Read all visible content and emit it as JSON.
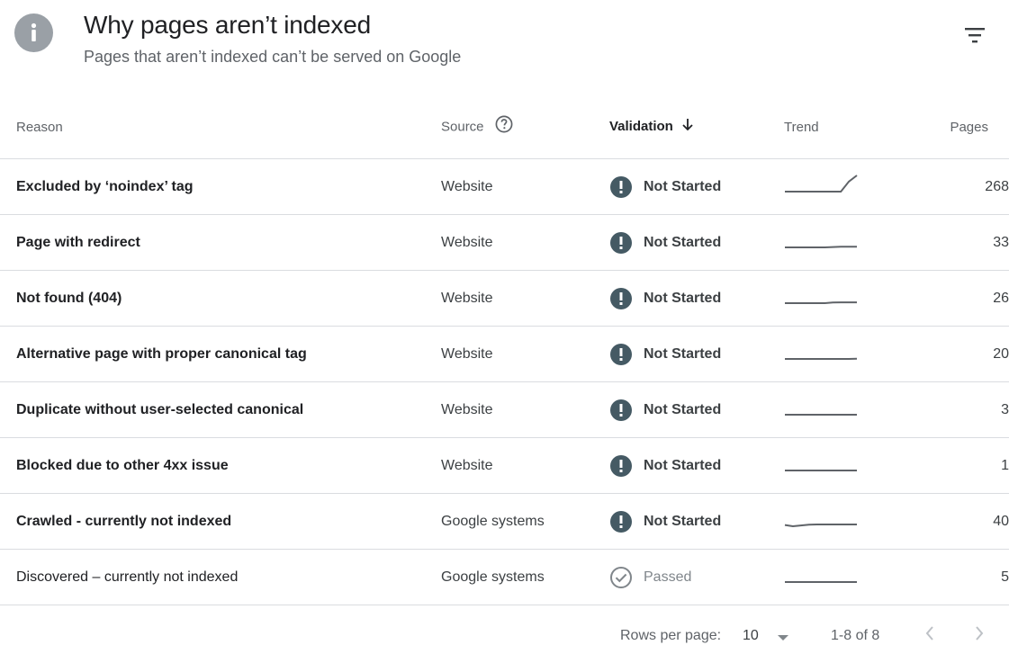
{
  "header": {
    "title": "Why pages aren’t indexed",
    "subtitle": "Pages that aren’t indexed can’t be served on Google",
    "info_icon": "info-icon",
    "filter_icon": "filter-icon"
  },
  "table": {
    "columns": {
      "reason": "Reason",
      "source": "Source",
      "validation": "Validation",
      "trend": "Trend",
      "pages": "Pages"
    },
    "sorted_by": "validation",
    "sort_direction": "descending",
    "rows": [
      {
        "reason": "Excluded by ‘noindex’ tag",
        "source": "Website",
        "validation": "Not Started",
        "status": "not-started",
        "pages": "268",
        "trend": [
          1,
          1,
          1,
          1,
          1,
          1,
          1,
          1,
          6,
          9
        ]
      },
      {
        "reason": "Page with redirect",
        "source": "Website",
        "validation": "Not Started",
        "status": "not-started",
        "pages": "33",
        "trend": [
          1,
          1,
          1,
          1,
          1,
          1,
          1.2,
          1.3,
          1.3,
          1.3
        ]
      },
      {
        "reason": "Not found (404)",
        "source": "Website",
        "validation": "Not Started",
        "status": "not-started",
        "pages": "26",
        "trend": [
          1,
          1,
          1,
          1,
          1,
          1,
          1.3,
          1.4,
          1.4,
          1.4
        ]
      },
      {
        "reason": "Alternative page with proper canonical tag",
        "source": "Website",
        "validation": "Not Started",
        "status": "not-started",
        "pages": "20",
        "trend": [
          1,
          1,
          1,
          1,
          1,
          1,
          1,
          1,
          1,
          1.1
        ]
      },
      {
        "reason": "Duplicate without user-selected canonical",
        "source": "Website",
        "validation": "Not Started",
        "status": "not-started",
        "pages": "3",
        "trend": [
          1,
          1,
          1,
          1,
          1,
          1,
          1,
          1,
          1,
          1
        ]
      },
      {
        "reason": "Blocked due to other 4xx issue",
        "source": "Website",
        "validation": "Not Started",
        "status": "not-started",
        "pages": "1",
        "trend": [
          1,
          1,
          1,
          1,
          1,
          1,
          1,
          1,
          1,
          1
        ]
      },
      {
        "reason": "Crawled - currently not indexed",
        "source": "Google systems",
        "validation": "Not Started",
        "status": "not-started",
        "pages": "40",
        "trend": [
          1.6,
          1,
          1.4,
          1.8,
          1.9,
          1.9,
          1.9,
          1.9,
          1.9,
          1.9
        ]
      },
      {
        "reason": "Discovered – currently not indexed",
        "source": "Google systems",
        "validation": "Passed",
        "status": "passed",
        "pages": "5",
        "trend": [
          1,
          1,
          1,
          1,
          1,
          1,
          1,
          1,
          1,
          1
        ]
      }
    ]
  },
  "footer": {
    "rows_per_page_label": "Rows per page:",
    "rows_per_page_value": "10",
    "range": "1-8 of 8"
  },
  "colors": {
    "not_started_icon": "#455a64",
    "passed_icon": "#80868b",
    "trend_line": "#5f6368"
  }
}
